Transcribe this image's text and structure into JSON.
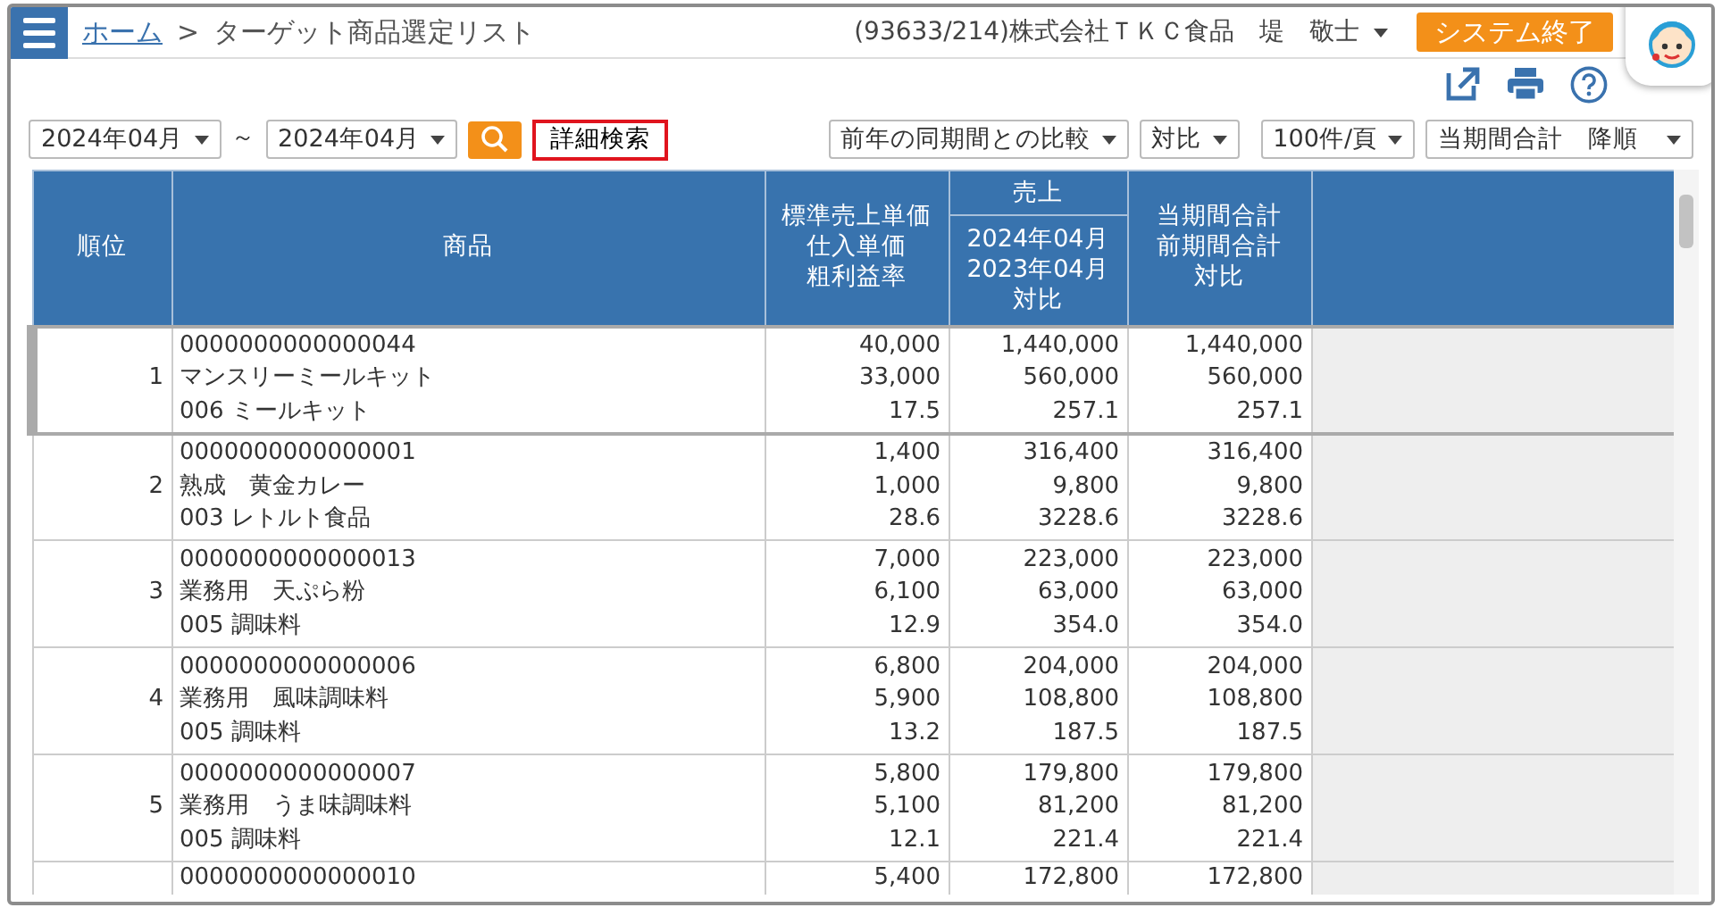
{
  "header": {
    "breadcrumb": [
      "ホーム",
      "ターゲット商品選定リスト"
    ],
    "separator": ">",
    "user": "(93633/214)株式会社ＴＫＣ食品　堤　敬士",
    "exit_button": "システム終了"
  },
  "toolbar": {
    "period_from": "2024年04月",
    "range_mark": "～",
    "period_to": "2024年04月",
    "detail_search": "詳細検索",
    "compare": "前年の同期間との比較",
    "ratio": "対比",
    "page_size": "100件/頁",
    "sort": "当期間合計　降順"
  },
  "table": {
    "columns": {
      "rank": "順位",
      "product": "商品",
      "price": [
        "標準売上単価",
        "仕入単価",
        "粗利益率"
      ],
      "sales_group": "売上",
      "sales": [
        "2024年04月",
        "2023年04月",
        "対比"
      ],
      "total": [
        "当期間合計",
        "前期間合計",
        "対比"
      ]
    },
    "rows": [
      {
        "selected": true,
        "rank": "1",
        "product": [
          "0000000000000044",
          "マンスリーミールキット",
          "006 ミールキット"
        ],
        "price": [
          "40,000",
          "33,000",
          "17.5"
        ],
        "sales": [
          "1,440,000",
          "560,000",
          "257.1"
        ],
        "total": [
          "1,440,000",
          "560,000",
          "257.1"
        ]
      },
      {
        "selected": false,
        "rank": "2",
        "product": [
          "0000000000000001",
          "熟成　黄金カレー",
          "003 レトルト食品"
        ],
        "price": [
          "1,400",
          "1,000",
          "28.6"
        ],
        "sales": [
          "316,400",
          "9,800",
          "3228.6"
        ],
        "total": [
          "316,400",
          "9,800",
          "3228.6"
        ]
      },
      {
        "selected": false,
        "rank": "3",
        "product": [
          "0000000000000013",
          "業務用　天ぷら粉",
          "005 調味料"
        ],
        "price": [
          "7,000",
          "6,100",
          "12.9"
        ],
        "sales": [
          "223,000",
          "63,000",
          "354.0"
        ],
        "total": [
          "223,000",
          "63,000",
          "354.0"
        ]
      },
      {
        "selected": false,
        "rank": "4",
        "product": [
          "0000000000000006",
          "業務用　風味調味料",
          "005 調味料"
        ],
        "price": [
          "6,800",
          "5,900",
          "13.2"
        ],
        "sales": [
          "204,000",
          "108,800",
          "187.5"
        ],
        "total": [
          "204,000",
          "108,800",
          "187.5"
        ]
      },
      {
        "selected": false,
        "rank": "5",
        "product": [
          "0000000000000007",
          "業務用　うま味調味料",
          "005 調味料"
        ],
        "price": [
          "5,800",
          "5,100",
          "12.1"
        ],
        "sales": [
          "179,800",
          "81,200",
          "221.4"
        ],
        "total": [
          "179,800",
          "81,200",
          "221.4"
        ]
      },
      {
        "selected": false,
        "product": [
          "0000000000000010"
        ],
        "price": [
          "5,400"
        ],
        "sales": [
          "172,800"
        ],
        "total": [
          "172,800"
        ]
      }
    ]
  }
}
